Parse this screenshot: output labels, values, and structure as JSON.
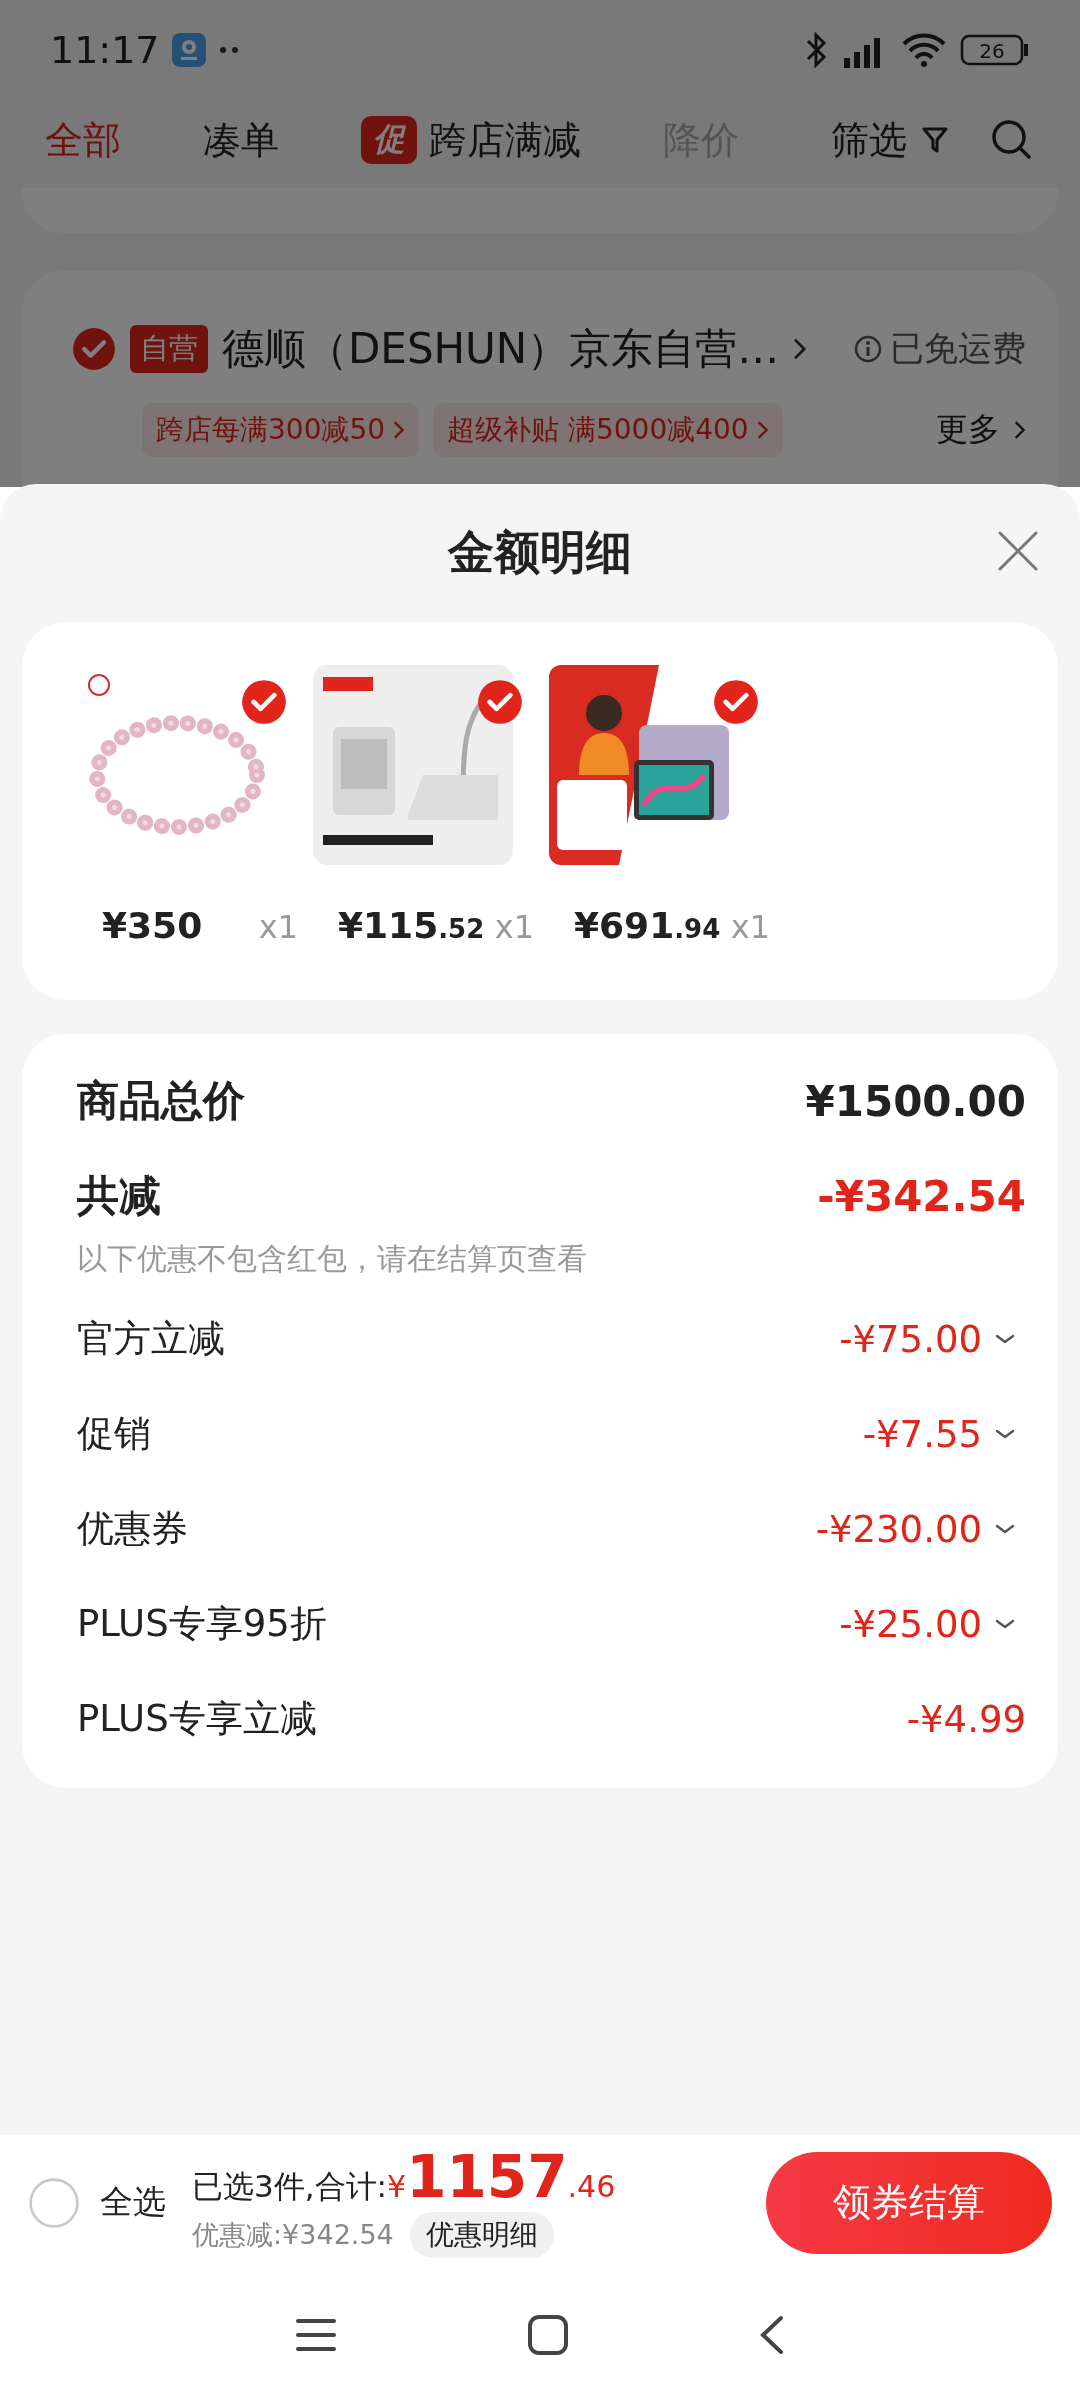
{
  "status_bar": {
    "time": "11:17",
    "battery": "26"
  },
  "tabs": [
    {
      "label": "全部",
      "selected": true,
      "disabled": false
    },
    {
      "label": "凑单",
      "selected": false,
      "disabled": false
    },
    {
      "label": "跨店满减",
      "badge": "促",
      "selected": false,
      "disabled": false
    },
    {
      "label": "降价",
      "selected": false,
      "disabled": true
    }
  ],
  "filter_button": {
    "label": "筛选"
  },
  "store": {
    "checked": true,
    "tag": "自营",
    "name": "德顺（DESHUN）京东自营…",
    "shipping": "已免运费",
    "promotions": [
      "跨店每满300减50",
      "超级补贴 满5000减400"
    ],
    "more": "更多"
  },
  "sheet": {
    "title": "金额明细",
    "products": [
      {
        "price": "¥350",
        "quantity": "x1",
        "selected": true
      },
      {
        "price": "¥115.52",
        "quantity": "x1",
        "selected": true
      },
      {
        "price": "¥691.94",
        "quantity": "x1",
        "selected": true
      }
    ],
    "breakdown": [
      {
        "kind": "total",
        "label": "商品总价",
        "amount": "¥1500.00"
      },
      {
        "kind": "discount_total",
        "label": "共减",
        "amount": "-¥342.54",
        "note": "以下优惠不包含红包，请在结算页查看"
      },
      {
        "kind": "item",
        "label": "官方立减",
        "amount": "-¥75.00",
        "expandable": true
      },
      {
        "kind": "item",
        "label": "促销",
        "amount": "-¥7.55",
        "expandable": true
      },
      {
        "kind": "item",
        "label": "优惠券",
        "amount": "-¥230.00",
        "expandable": true
      },
      {
        "kind": "item",
        "label": "PLUS专享95折",
        "amount": "-¥25.00",
        "expandable": true
      },
      {
        "kind": "item",
        "label": "PLUS专享立减",
        "amount": "-¥4.99",
        "expandable": false
      }
    ]
  },
  "bottom_bar": {
    "select_all": {
      "label": "全选",
      "checked": false
    },
    "summary": "已选3件,合计:",
    "total": "¥1157.46",
    "discount": "优惠减:¥342.54",
    "details_button": "优惠明细",
    "checkout_button": "领券结算"
  }
}
